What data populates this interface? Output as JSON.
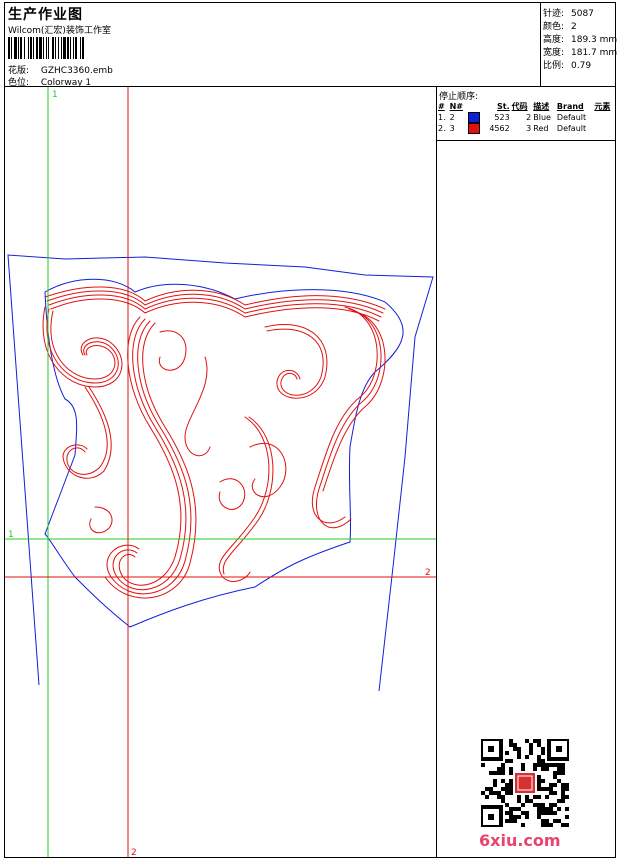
{
  "header": {
    "title": "生产作业图",
    "company": "Wilcom(汇宏)装饰工作室",
    "design_label": "花版:",
    "design_value": "GZHC3360.emb",
    "colorway_label": "色位:",
    "colorway_value": "Colorway 1"
  },
  "specs": [
    {
      "label": "针迹:",
      "value": "5087"
    },
    {
      "label": "颜色:",
      "value": "2"
    },
    {
      "label": "高度:",
      "value": "189.3 mm"
    },
    {
      "label": "宽度:",
      "value": "181.7 mm"
    },
    {
      "label": "比例:",
      "value": "0.79"
    }
  ],
  "stop_sequence": {
    "title": "停止顺序:",
    "columns": [
      "#",
      "N#",
      "St.",
      "代码",
      "描述",
      "Brand",
      "元素"
    ],
    "rows": [
      {
        "num": "1.",
        "n": "2",
        "color": "#1020d8",
        "stitches": "523",
        "code": "2",
        "desc": "Blue",
        "brand": "Default",
        "element": ""
      },
      {
        "num": "2.",
        "n": "3",
        "color": "#e01010",
        "stitches": "4562",
        "code": "3",
        "desc": "Red",
        "brand": "Default",
        "element": ""
      }
    ]
  },
  "guides": {
    "green_v": "1",
    "green_h": "1",
    "red_v": "2",
    "red_h": "2"
  },
  "colors": {
    "outline": "#1020d8",
    "embroidery": "#e01010",
    "guide_green": "#22cc22",
    "guide_red": "#e01010"
  },
  "watermark": "6xiu.com"
}
